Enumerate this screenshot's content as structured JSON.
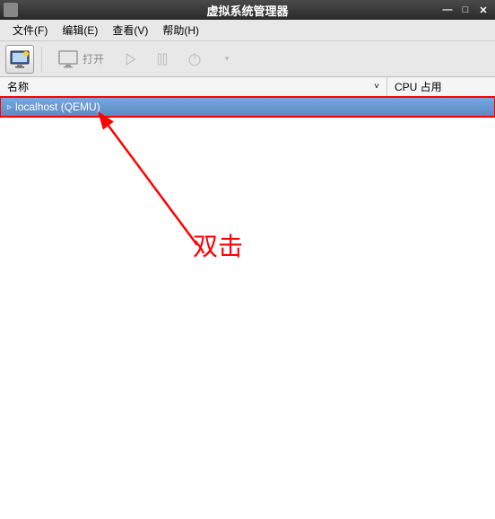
{
  "titlebar": {
    "title": "虚拟系统管理器",
    "minimize": "—",
    "maximize": "□",
    "close": "✕"
  },
  "menubar": {
    "file": "文件(F)",
    "edit": "编辑(E)",
    "view": "查看(V)",
    "help": "帮助(H)"
  },
  "toolbar": {
    "open_label": "打开"
  },
  "headers": {
    "name": "名称",
    "cpu": "CPU 占用",
    "sort": "˅"
  },
  "list": {
    "items": [
      {
        "expander": "▹",
        "label": "localhost (QEMU)"
      }
    ]
  },
  "annotation": {
    "text": "双击"
  }
}
